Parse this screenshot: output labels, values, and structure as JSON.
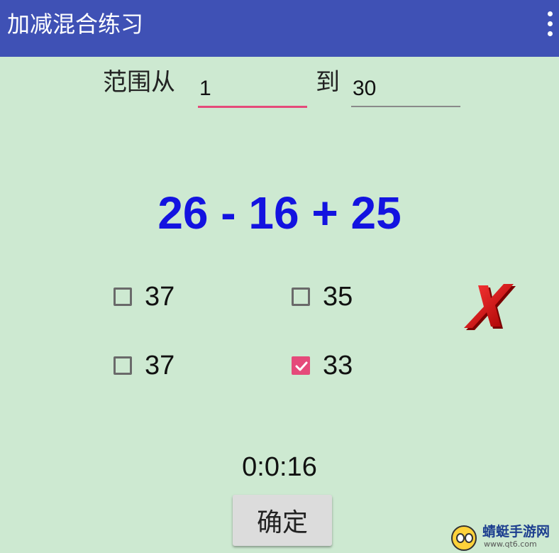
{
  "app": {
    "title": "加减混合练习",
    "menu_icon": "more-vert-icon",
    "accent_color": "#3f51b5"
  },
  "range": {
    "from_label": "范围从",
    "from_value": "1",
    "to_label": "到",
    "to_value": "30",
    "focused_line_color": "#e54a7a"
  },
  "question": {
    "expression": "26 - 16 + 25"
  },
  "options": [
    {
      "label": "37",
      "checked": false
    },
    {
      "label": "35",
      "checked": false
    },
    {
      "label": "37",
      "checked": false
    },
    {
      "label": "33",
      "checked": true
    }
  ],
  "result": {
    "icon": "wrong-x-icon",
    "color": "#d41414"
  },
  "timer": "0:0:16",
  "confirm_label": "确定",
  "watermark": {
    "text": "蜻蜓手游网",
    "url": "www.qt6.com"
  }
}
